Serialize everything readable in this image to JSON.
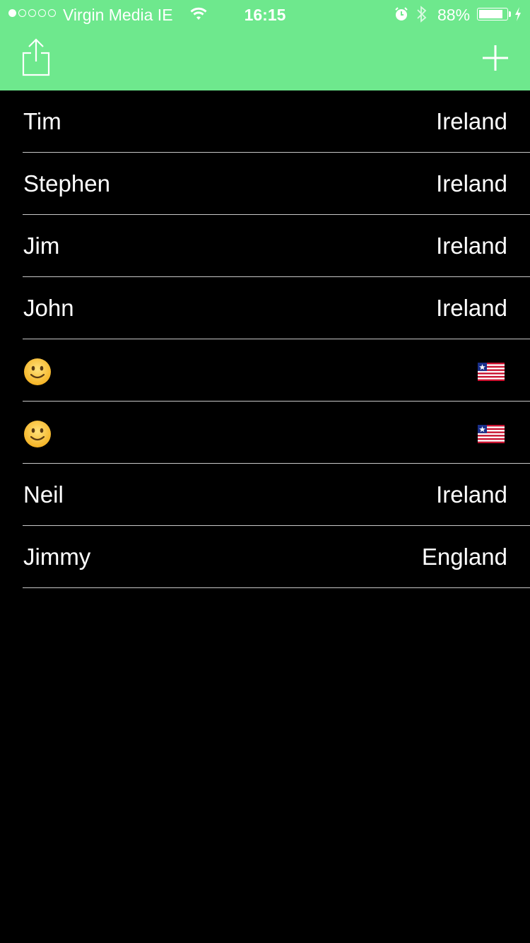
{
  "status_bar": {
    "carrier": "Virgin Media IE",
    "time": "16:15",
    "battery": "88%",
    "signal_strength": 1
  },
  "nav": {
    "share_icon": "share-icon",
    "add_icon": "plus-icon",
    "bar_color": "#6ee88d"
  },
  "people": [
    {
      "name": "Tim",
      "country": "Ireland"
    },
    {
      "name": "Stephen",
      "country": "Ireland"
    },
    {
      "name": "Jim",
      "country": "Ireland"
    },
    {
      "name": "John",
      "country": "Ireland"
    },
    {
      "name_icon": "smiley-emoji",
      "country_icon": "liberia-flag-emoji"
    },
    {
      "name_icon": "smiley-emoji",
      "country_icon": "liberia-flag-emoji"
    },
    {
      "name": "Neil",
      "country": "Ireland"
    },
    {
      "name": "Jimmy",
      "country": "England"
    }
  ]
}
